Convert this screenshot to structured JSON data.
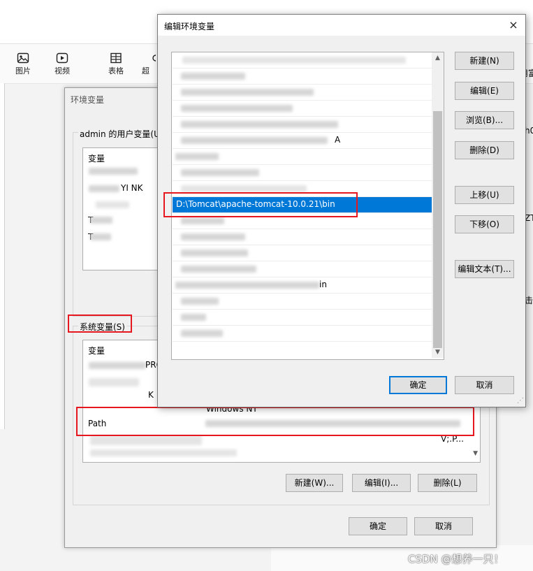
{
  "toolbar": {
    "items": [
      {
        "label": "图片",
        "icon": "image-icon"
      },
      {
        "label": "视频",
        "icon": "video-icon"
      },
      {
        "label": "表格",
        "icon": "table-icon"
      },
      {
        "label": "超",
        "icon": "link-icon"
      }
    ],
    "right_fragment": "用富"
  },
  "env_dialog": {
    "title": "环境变量",
    "user_group_label": "admin 的用户变量(U",
    "user_list_header": "变量",
    "user_rows": [
      "",
      "YI NK",
      "",
      "T",
      "T"
    ],
    "system_group_label": "系统变量(S)",
    "system_list_header": "变量",
    "system_rows": [
      {
        "name": "",
        "value": "PRO"
      },
      {
        "name": "",
        "value": "K"
      },
      {
        "name": "",
        "value": "Windows NT"
      },
      {
        "name": "Path",
        "value": ""
      },
      {
        "name": "",
        "value": "V;.P..."
      }
    ],
    "buttons": {
      "new": "新建(W)...",
      "edit": "编辑(I)...",
      "delete": "删除(L)"
    },
    "ok": "确定",
    "cancel": "取消",
    "side_fragments": [
      "h0",
      "ZT",
      "击"
    ]
  },
  "edit_dialog": {
    "title": "编辑环境变量",
    "close": "×",
    "rows": [
      "",
      "",
      "",
      "",
      "",
      "A",
      "",
      "",
      "",
      "D:\\Tomcat\\apache-tomcat-10.0.21\\bin",
      "",
      "",
      "",
      "",
      "",
      "in",
      "",
      "",
      ""
    ],
    "selected_index": 9,
    "buttons": {
      "new": "新建(N)",
      "edit": "编辑(E)",
      "browse": "浏览(B)...",
      "delete": "删除(D)",
      "up": "上移(U)",
      "down": "下移(O)",
      "edit_text": "编辑文本(T)..."
    },
    "ok": "确定",
    "cancel": "取消"
  },
  "watermark": "CSDN @想养一只！",
  "colors": {
    "selection": "#0078d7",
    "highlight_box": "#e6171f"
  }
}
